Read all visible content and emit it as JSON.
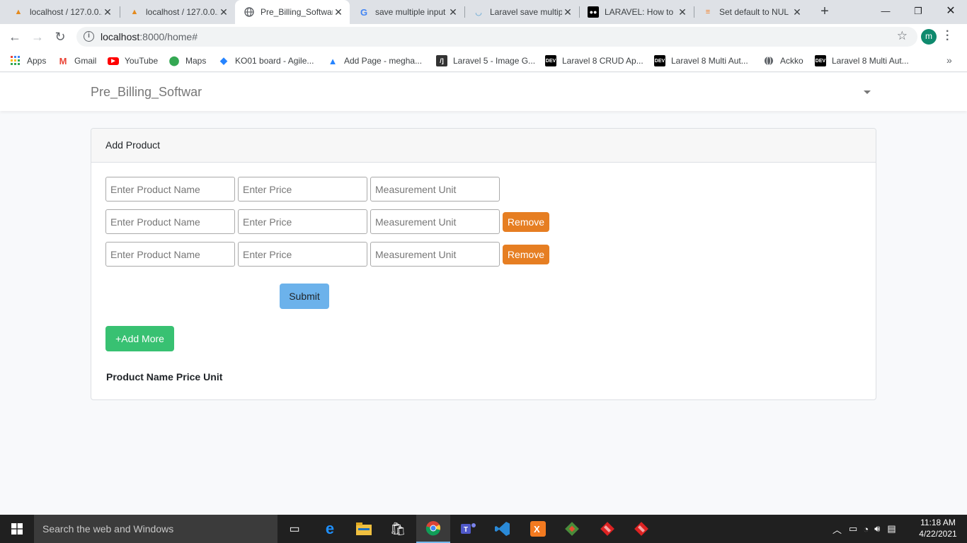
{
  "browser": {
    "tabs": [
      {
        "title": "localhost / 127.0.0.1",
        "icon": "phpmyadmin-icon",
        "active": false
      },
      {
        "title": "localhost / 127.0.0.1",
        "icon": "phpmyadmin-icon",
        "active": false
      },
      {
        "title": "Pre_Billing_Softwar",
        "icon": "globe-icon",
        "active": true
      },
      {
        "title": "save multiple input",
        "icon": "google-icon",
        "active": false
      },
      {
        "title": "Laravel save multip",
        "icon": "laravel-icon",
        "active": false
      },
      {
        "title": "LARAVEL: How to",
        "icon": "medium-icon",
        "active": false
      },
      {
        "title": "Set default to NUL",
        "icon": "stackoverflow-icon",
        "active": false
      }
    ],
    "url_host": "localhost",
    "url_rest": ":8000/home#",
    "profile_initial": "m",
    "bookmarks": [
      {
        "label": "Apps",
        "icon": "apps-grid-icon"
      },
      {
        "label": "Gmail",
        "icon": "gmail-icon"
      },
      {
        "label": "YouTube",
        "icon": "youtube-icon"
      },
      {
        "label": "Maps",
        "icon": "maps-icon"
      },
      {
        "label": "KO01 board - Agile...",
        "icon": "jira-icon"
      },
      {
        "label": "Add Page - megha...",
        "icon": "confluence-icon"
      },
      {
        "label": "Laravel 5 - Image G...",
        "icon": "itsolutionstuff-icon"
      },
      {
        "label": "Laravel 8 CRUD Ap...",
        "icon": "dev-icon"
      },
      {
        "label": "Laravel 8 Multi Aut...",
        "icon": "dev-icon"
      },
      {
        "label": "Ackko",
        "icon": "globe-icon"
      },
      {
        "label": "Laravel 8 Multi Aut...",
        "icon": "dev-icon"
      }
    ]
  },
  "app": {
    "brand": "Pre_Billing_Softwar"
  },
  "card": {
    "header": "Add Product",
    "rows": [
      {
        "name_placeholder": "Enter Product Name",
        "price_placeholder": "Enter Price",
        "unit_placeholder": "Measurement Unit",
        "removable": false
      },
      {
        "name_placeholder": "Enter Product Name",
        "price_placeholder": "Enter Price",
        "unit_placeholder": "Measurement Unit",
        "removable": true
      },
      {
        "name_placeholder": "Enter Product Name",
        "price_placeholder": "Enter Price",
        "unit_placeholder": "Measurement Unit",
        "removable": true
      }
    ],
    "remove_label": "Remove",
    "submit_label": "Submit",
    "add_more_label": "+Add More",
    "table_headers": [
      "Product Name",
      "Price",
      "Unit"
    ]
  },
  "taskbar": {
    "search_placeholder": "Search the web and Windows",
    "time": "11:18 AM",
    "date": "4/22/2021"
  }
}
